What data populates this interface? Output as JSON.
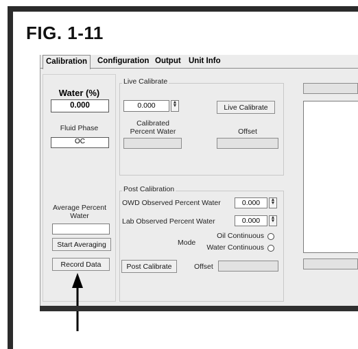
{
  "figure": {
    "title": "FIG. 1-11"
  },
  "tabs": [
    {
      "label": "Calibration",
      "active": true
    },
    {
      "label": "Configuration",
      "active": false
    },
    {
      "label": "Output",
      "active": false
    },
    {
      "label": "Unit Info",
      "active": false
    }
  ],
  "left_panel": {
    "water_title": "Water (%)",
    "water_value": "0.000",
    "fluid_phase_label": "Fluid Phase",
    "fluid_phase_value": "OC",
    "average_label": "Average Percent Water",
    "average_value": "",
    "start_averaging_label": "Start Averaging",
    "record_data_label": "Record Data"
  },
  "live_calibrate": {
    "legend": "Live Calibrate",
    "input_value": "0.000",
    "button_label": "Live Calibrate",
    "calibrated_label": "Calibrated Percent Water",
    "offset_label": "Offset",
    "calibrated_value": "",
    "offset_value": ""
  },
  "post_calibration": {
    "legend": "Post Calibration",
    "owd_label": "OWD Observed Percent Water",
    "owd_value": "0.000",
    "lab_label": "Lab Observed Percent Water",
    "lab_value": "0.000",
    "mode_label": "Mode",
    "mode_options": [
      {
        "label": "Oil Continuous",
        "selected": false
      },
      {
        "label": "Water Continuous",
        "selected": false
      }
    ],
    "button_label": "Post Calibrate",
    "offset_label": "Offset",
    "offset_value": ""
  },
  "right_panel": {
    "top_value": "",
    "bottom_value": ""
  },
  "colors": {
    "window_bg": "#ececec",
    "frame": "#2b2b2b"
  }
}
